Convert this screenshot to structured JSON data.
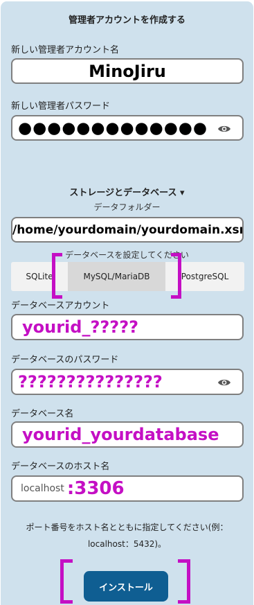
{
  "form": {
    "title": "管理者アカウントを作成する",
    "admin_user_label": "新しい管理者アカウント名",
    "admin_user_value": "MinoJiru",
    "admin_pass_label": "新しい管理者パスワード",
    "admin_pass_value": "●●●●●●●●●●●●●",
    "storage_toggle": "ストレージとデータベース ▾",
    "data_folder_label": "データフォルダー",
    "data_folder_value": "/home/yourdomain/yourdomain.xsrv",
    "db_configure_label": "データベースを設定してください",
    "db_options": [
      "SQLite",
      "MySQL/MariaDB",
      "PostgreSQL"
    ],
    "db_selected": "MySQL/MariaDB",
    "db_user_label": "データベースアカウント",
    "db_user_value": "yourid_?????",
    "db_pass_label": "データベースのパスワード",
    "db_pass_value": "???????????????",
    "db_name_label": "データベース名",
    "db_name_value": "yourid_yourdatabase",
    "db_host_label": "データベースのホスト名",
    "db_host_value": "localhost",
    "db_host_port": ":3306",
    "port_hint_line1": "ポート番号をホスト名とともに指定してください(例：",
    "port_hint_line2": "localhost：5432)。",
    "install_button": "インストール"
  },
  "icons": [
    "eye-icon",
    "chevron-down-icon"
  ],
  "colors": {
    "panel_bg": "#cfe1ed",
    "annotation": "#c40fc4",
    "button_bg": "#0f5e92"
  }
}
